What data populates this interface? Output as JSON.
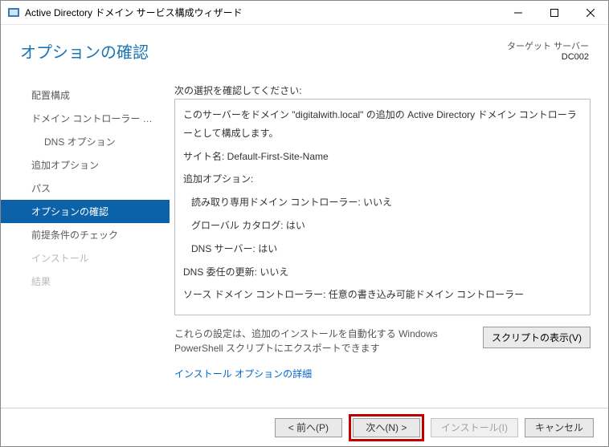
{
  "window": {
    "title": "Active Directory ドメイン サービス構成ウィザード"
  },
  "header": {
    "title": "オプションの確認",
    "target_label": "ターゲット サーバー",
    "target_value": "DC002"
  },
  "sidebar": {
    "items": [
      {
        "label": "配置構成",
        "state": "done",
        "level": 1
      },
      {
        "label": "ドメイン コントローラー オプシ...",
        "state": "done",
        "level": 1
      },
      {
        "label": "DNS オプション",
        "state": "done",
        "level": 2
      },
      {
        "label": "追加オプション",
        "state": "done",
        "level": 1
      },
      {
        "label": "パス",
        "state": "done",
        "level": 1
      },
      {
        "label": "オプションの確認",
        "state": "active",
        "level": 1
      },
      {
        "label": "前提条件のチェック",
        "state": "done",
        "level": 1
      },
      {
        "label": "インストール",
        "state": "disabled",
        "level": 1
      },
      {
        "label": "結果",
        "state": "disabled",
        "level": 1
      }
    ]
  },
  "main": {
    "instruction": "次の選択を確認してください:",
    "review_lines": [
      {
        "text": "このサーバーをドメイン \"digitalwith.local\" の追加の Active Directory ドメイン コントローラーとして構成します。",
        "indent": false
      },
      {
        "text": "サイト名: Default-First-Site-Name",
        "indent": false
      },
      {
        "text": "追加オプション:",
        "indent": false
      },
      {
        "text": "読み取り専用ドメイン コントローラー: いいえ",
        "indent": true
      },
      {
        "text": "グローバル カタログ: はい",
        "indent": true
      },
      {
        "text": "DNS サーバー: はい",
        "indent": true
      },
      {
        "text": "DNS 委任の更新: いいえ",
        "indent": false
      },
      {
        "text": "ソース ドメイン コントローラー: 任意の書き込み可能ドメイン コントローラー",
        "indent": false
      }
    ],
    "note": "これらの設定は、追加のインストールを自動化する Windows PowerShell スクリプトにエクスポートできます",
    "script_button": "スクリプトの表示(V)",
    "link": "インストール オプションの詳細"
  },
  "footer": {
    "prev": "< 前へ(P)",
    "next": "次へ(N) >",
    "install": "インストール(I)",
    "cancel": "キャンセル"
  }
}
